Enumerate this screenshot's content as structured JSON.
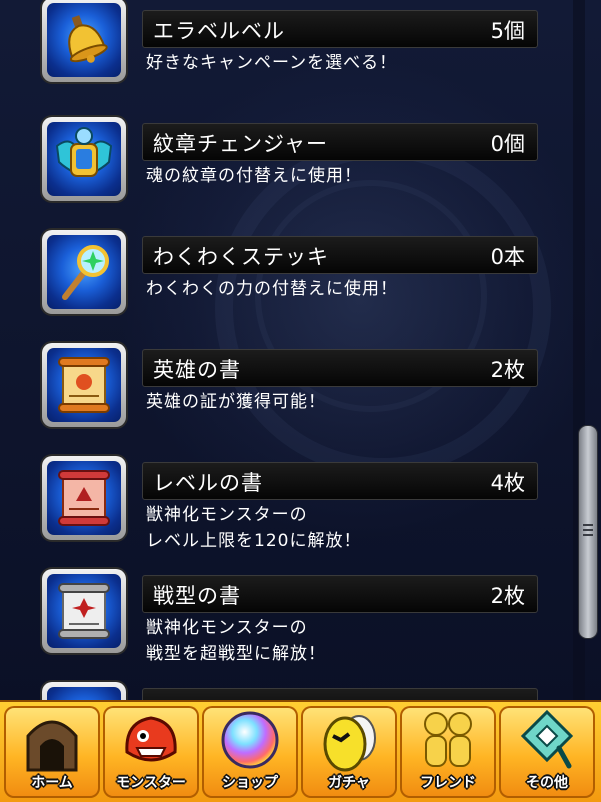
{
  "items": [
    {
      "name": "エラベルベル",
      "count": "5個",
      "desc": "好きなキャンペーンを選べる！",
      "icon": "bell-icon"
    },
    {
      "name": "紋章チェンジャー",
      "count": "0個",
      "desc": "魂の紋章の付替えに使用！",
      "icon": "crest-changer-icon"
    },
    {
      "name": "わくわくステッキ",
      "count": "0本",
      "desc": "わくわくの力の付替えに使用！",
      "icon": "wand-icon"
    },
    {
      "name": "英雄の書",
      "count": "2枚",
      "desc": "英雄の証が獲得可能！",
      "icon": "scroll-hero-icon"
    },
    {
      "name": "レベルの書",
      "count": "4枚",
      "desc": "獣神化モンスターの\nレベル上限を120に解放！",
      "icon": "scroll-level-icon"
    },
    {
      "name": "戦型の書",
      "count": "2枚",
      "desc": "獣神化モンスターの\n戦型を超戦型に解放！",
      "icon": "scroll-battletype-icon"
    }
  ],
  "tabs": [
    {
      "label": "ホーム",
      "icon": "home-gate-icon"
    },
    {
      "label": "モンスター",
      "icon": "monster-icon"
    },
    {
      "label": "ショップ",
      "icon": "orb-icon"
    },
    {
      "label": "ガチャ",
      "icon": "egg-icon"
    },
    {
      "label": "フレンド",
      "icon": "friends-icon"
    },
    {
      "label": "その他",
      "icon": "other-icon"
    }
  ],
  "colors": {
    "tab_bar": "#ffb524",
    "name_bar": "#0d0d0d",
    "icon_bg": "#1a5fd8"
  }
}
